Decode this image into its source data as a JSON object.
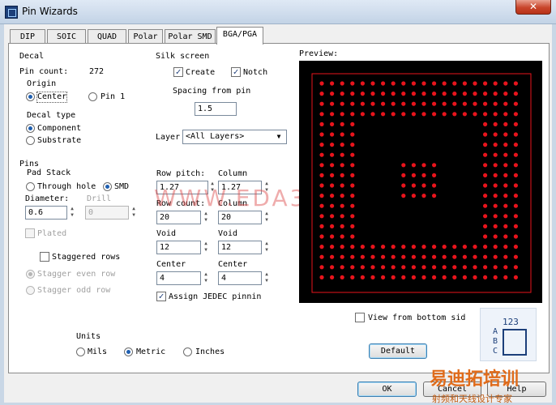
{
  "window": {
    "title": "Pin Wizards",
    "close_symbol": "✕"
  },
  "tabs": [
    {
      "label": "DIP"
    },
    {
      "label": "SOIC"
    },
    {
      "label": "QUAD"
    },
    {
      "label": "Polar"
    },
    {
      "label": "Polar SMD"
    },
    {
      "label": "BGA/PGA",
      "active": true
    }
  ],
  "decal": {
    "section": "Decal",
    "pin_count_label": "Pin count:",
    "pin_count_value": "272",
    "origin_label": "Origin",
    "origin_center": "Center",
    "origin_pin1": "Pin 1",
    "origin_selected": "Center",
    "decal_type_label": "Decal type",
    "type_component": "Component",
    "type_substrate": "Substrate",
    "type_selected": "Component"
  },
  "silk": {
    "section": "Silk screen",
    "create_label": "Create",
    "create_checked": true,
    "notch_label": "Notch",
    "notch_checked": true,
    "spacing_label": "Spacing from pin",
    "spacing_value": "1.5"
  },
  "layer": {
    "label": "Layer",
    "value": "<All Layers>"
  },
  "pins": {
    "section": "Pins",
    "pad_stack_label": "Pad Stack",
    "through_hole": "Through hole",
    "smd": "SMD",
    "selected": "SMD",
    "diameter_label": "Diameter:",
    "diameter_value": "0.6",
    "drill_label": "Drill",
    "drill_value": "0",
    "plated_label": "Plated",
    "staggered_label": "Staggered rows",
    "stagger_even": "Stagger even row",
    "stagger_odd": "Stagger odd row"
  },
  "grid": {
    "row_pitch_label": "Row pitch:",
    "row_pitch_value": "1.27",
    "col_pitch_label": "Column",
    "col_pitch_value": "1.27",
    "row_count_label": "Row count:",
    "row_count_value": "20",
    "col_count_label": "Column",
    "col_count_value": "20",
    "void_row_label": "Void",
    "void_row_value": "12",
    "void_col_label": "Void",
    "void_col_value": "12",
    "center_row_label": "Center",
    "center_row_value": "4",
    "center_col_label": "Center",
    "center_col_value": "4",
    "jedec_label": "Assign JEDEC pinnin",
    "jedec_checked": true
  },
  "preview": {
    "label": "Preview:",
    "pad_color": "#e8141c",
    "outline_color": "#e8141c",
    "background": "#000000"
  },
  "view_bottom_label": "View from bottom sid",
  "default_button": "Default",
  "units": {
    "label": "Units",
    "mils": "Mils",
    "metric": "Metric",
    "inches": "Inches",
    "selected": "Metric"
  },
  "jedec_icon": {
    "numbers": "123",
    "letters": [
      "A",
      "B",
      "C"
    ]
  },
  "buttons": {
    "ok": "OK",
    "cancel": "Cancel",
    "help": "Help"
  },
  "watermark": "WWW.EDA365.COM",
  "brand": {
    "name": "易迪拓培训",
    "tagline": "射频和天线设计专家"
  }
}
